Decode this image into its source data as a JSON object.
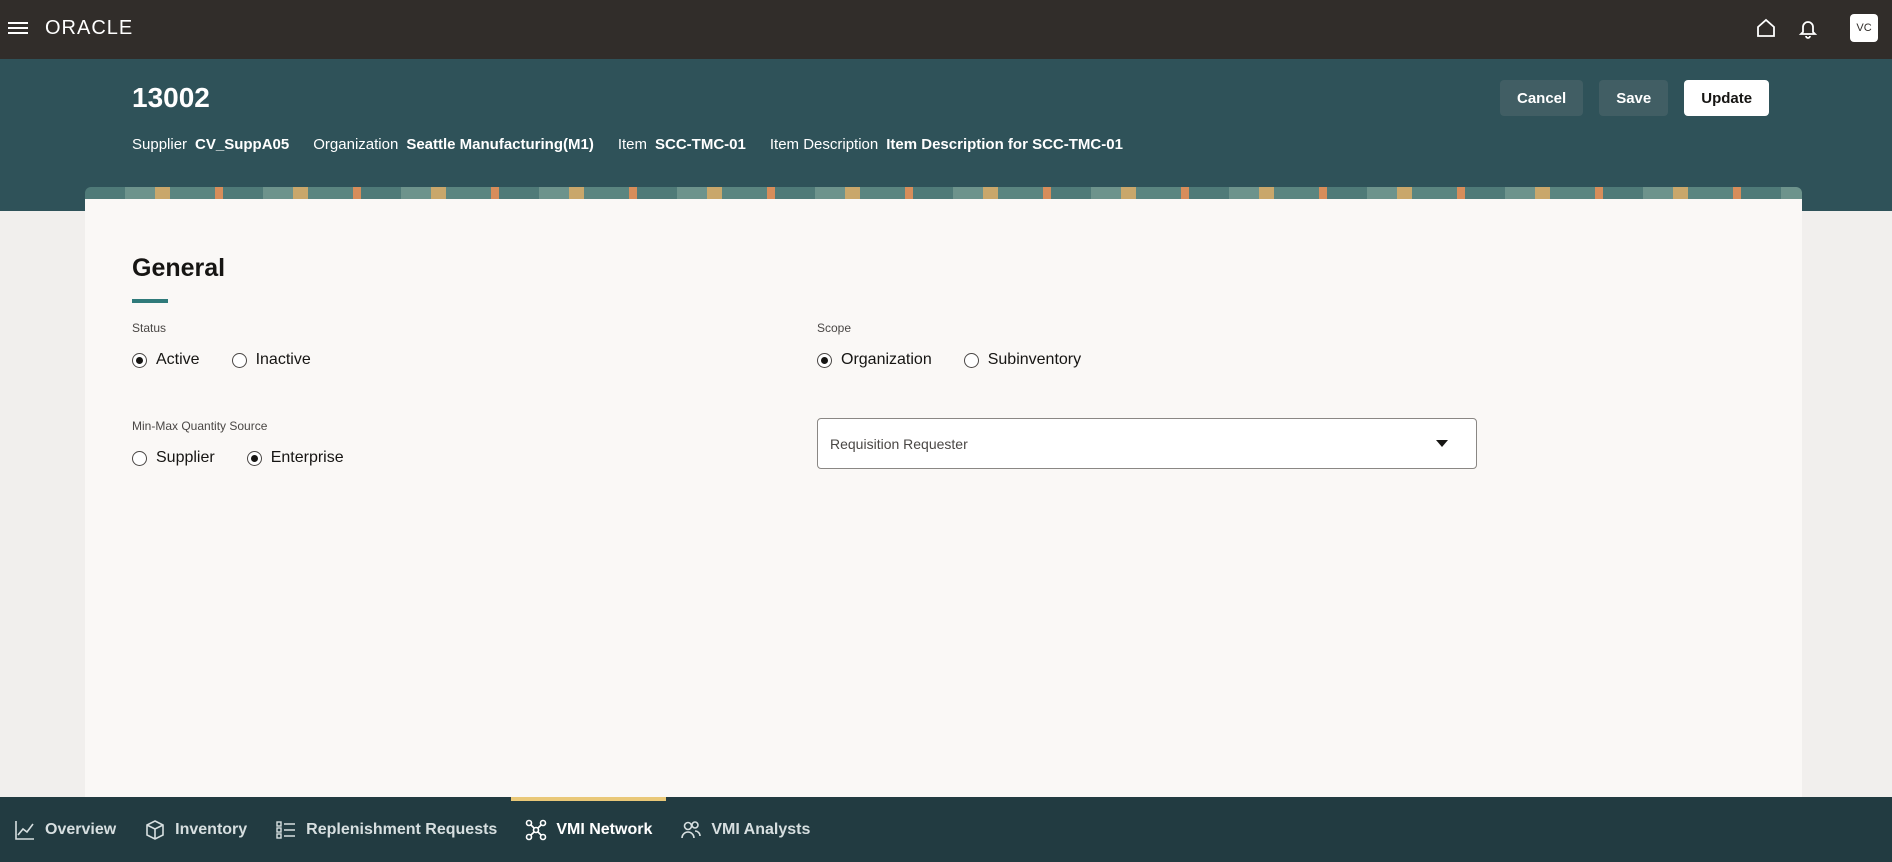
{
  "app": {
    "brand": "ORACLE",
    "avatar_initials": "VC"
  },
  "header": {
    "title": "13002",
    "buttons": {
      "cancel": "Cancel",
      "save": "Save",
      "update": "Update"
    },
    "meta": [
      {
        "label": "Supplier",
        "value": "CV_SuppA05"
      },
      {
        "label": "Organization",
        "value": "Seattle Manufacturing(M1)"
      },
      {
        "label": "Item",
        "value": "SCC-TMC-01"
      },
      {
        "label": "Item Description",
        "value": "Item Description for SCC-TMC-01"
      }
    ]
  },
  "general": {
    "title": "General",
    "status": {
      "label": "Status",
      "options": [
        "Active",
        "Inactive"
      ],
      "selected": "Active"
    },
    "scope": {
      "label": "Scope",
      "options": [
        "Organization",
        "Subinventory"
      ],
      "selected": "Organization"
    },
    "minmax": {
      "label": "Min-Max Quantity Source",
      "options": [
        "Supplier",
        "Enterprise"
      ],
      "selected": "Enterprise"
    },
    "requester": {
      "placeholder": "Requisition Requester"
    }
  },
  "bottom_nav": {
    "tabs": [
      {
        "label": "Overview",
        "icon": "chart-line-icon"
      },
      {
        "label": "Inventory",
        "icon": "cube-icon"
      },
      {
        "label": "Replenishment Requests",
        "icon": "list-icon"
      },
      {
        "label": "VMI Network",
        "icon": "network-icon"
      },
      {
        "label": "VMI Analysts",
        "icon": "users-icon"
      }
    ],
    "active": "VMI Network"
  },
  "colors": {
    "topbar": "#312d2a",
    "header": "#2f5259",
    "bottom_nav": "#223b41",
    "active_tab_accent": "#e9c878"
  }
}
